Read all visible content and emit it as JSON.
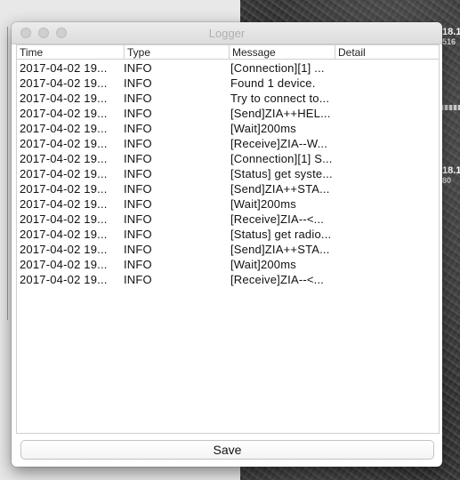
{
  "window": {
    "title": "Logger"
  },
  "table": {
    "columns": [
      "Time",
      "Type",
      "Message",
      "Detail"
    ],
    "rows": [
      [
        "2017-04-02 19...",
        "INFO",
        "[Connection][1] ...",
        ""
      ],
      [
        "2017-04-02 19...",
        "INFO",
        "Found 1 device.",
        ""
      ],
      [
        "2017-04-02 19...",
        "INFO",
        "Try to connect to...",
        ""
      ],
      [
        "2017-04-02 19...",
        "INFO",
        "[Send]ZIA++HEL...",
        ""
      ],
      [
        "2017-04-02 19...",
        "INFO",
        "[Wait]200ms",
        ""
      ],
      [
        "2017-04-02 19...",
        "INFO",
        "[Receive]ZIA--W...",
        ""
      ],
      [
        "2017-04-02 19...",
        "INFO",
        "[Connection][1] S...",
        ""
      ],
      [
        "2017-04-02 19...",
        "INFO",
        "[Status] get syste...",
        ""
      ],
      [
        "2017-04-02 19...",
        "INFO",
        "[Send]ZIA++STA...",
        ""
      ],
      [
        "2017-04-02 19...",
        "INFO",
        "[Wait]200ms",
        ""
      ],
      [
        "2017-04-02 19...",
        "INFO",
        "[Receive]ZIA--<...",
        ""
      ],
      [
        "2017-04-02 19...",
        "INFO",
        "[Status] get radio...",
        ""
      ],
      [
        "2017-04-02 19...",
        "INFO",
        "[Send]ZIA++STA...",
        ""
      ],
      [
        "2017-04-02 19...",
        "INFO",
        "[Wait]200ms",
        ""
      ],
      [
        "2017-04-02 19...",
        "INFO",
        "[Receive]ZIA--<...",
        ""
      ]
    ]
  },
  "footer": {
    "save_label": "Save"
  },
  "background": {
    "side_labels": [
      {
        "main": "18.1",
        "sub": "516"
      },
      {
        "main": "18.1",
        "sub": "80"
      }
    ]
  }
}
